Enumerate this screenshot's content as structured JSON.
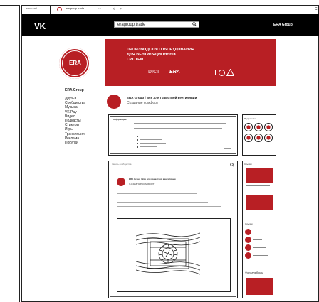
{
  "browser": {
    "url_short": "www.eml...",
    "tab_title": "eragroup.trade",
    "tab_more": "···",
    "nav_back": "<",
    "nav_forward": ">",
    "reload": "C"
  },
  "vk": {
    "logo": "VK",
    "search_value": "eragroup.trade",
    "user_name": "ERA Group"
  },
  "left_nav": {
    "group_name": "ERA Group",
    "logo_text": "ERA",
    "items": [
      "Друзья",
      "Сообщества",
      "Музыка",
      "VK Pay",
      "Видео",
      "Подкасты",
      "Стикеры",
      "Игры",
      "Трансляции",
      "Реклама",
      "Покупки"
    ]
  },
  "cover": {
    "headline_line1": "ПРОИЗВОДСТВО ОБОРУДОВАНИЯ",
    "headline_line2": "ДЛЯ ВЕНТИЛЯЦИОННЫХ",
    "headline_line3": "СИСТЕМ",
    "brand_dict": "DICT",
    "brand_era": "ERA"
  },
  "group": {
    "title": "ERA Group | Все для грамотной вентиляции",
    "status": "Создание комфорт"
  },
  "info": {
    "header": "Информация"
  },
  "subscribers": {
    "header": "Подписчики"
  },
  "search_bar": {
    "placeholder": "Запись сообщества"
  },
  "post": {
    "author": "ERA Group | Все для грамотной вентиляции",
    "subtitle": "Создание комфорт"
  },
  "right_column": {
    "header": "Ссылки",
    "links_header": "Ссылки",
    "photos_header": "Фотоальбомы"
  },
  "colors": {
    "accent": "#b81f24",
    "line": "#222222"
  },
  "icons": [
    "vk-logo-icon",
    "search-icon",
    "back-icon",
    "forward-icon",
    "reload-icon",
    "era-logo-icon",
    "fan-grille-icon"
  ]
}
